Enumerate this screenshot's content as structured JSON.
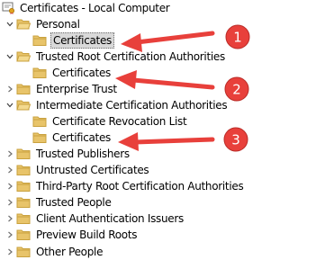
{
  "tree": {
    "root": {
      "label": "Certificates - Local Computer",
      "icon": "certificate-store-icon"
    },
    "items": [
      {
        "label": "Personal",
        "state": "expanded",
        "icon": "folder-open-icon"
      },
      {
        "label": "Certificates",
        "state": "leaf",
        "icon": "folder-icon",
        "selected": true
      },
      {
        "label": "Trusted Root Certification Authorities",
        "state": "expanded",
        "icon": "folder-open-icon"
      },
      {
        "label": "Certificates",
        "state": "leaf",
        "icon": "folder-icon"
      },
      {
        "label": "Enterprise Trust",
        "state": "collapsed",
        "icon": "folder-icon"
      },
      {
        "label": "Intermediate Certification Authorities",
        "state": "expanded",
        "icon": "folder-open-icon"
      },
      {
        "label": "Certificate Revocation List",
        "state": "leaf",
        "icon": "folder-icon"
      },
      {
        "label": "Certificates",
        "state": "leaf",
        "icon": "folder-icon"
      },
      {
        "label": "Trusted Publishers",
        "state": "collapsed",
        "icon": "folder-icon"
      },
      {
        "label": "Untrusted Certificates",
        "state": "collapsed",
        "icon": "folder-icon"
      },
      {
        "label": "Third-Party Root Certification Authorities",
        "state": "collapsed",
        "icon": "folder-icon"
      },
      {
        "label": "Trusted People",
        "state": "collapsed",
        "icon": "folder-icon"
      },
      {
        "label": "Client Authentication Issuers",
        "state": "collapsed",
        "icon": "folder-icon"
      },
      {
        "label": "Preview Build Roots",
        "state": "collapsed",
        "icon": "folder-icon"
      },
      {
        "label": "Other People",
        "state": "collapsed",
        "icon": "folder-icon"
      }
    ]
  },
  "annotations": {
    "color": "#e8403b",
    "badges": [
      {
        "number": "1"
      },
      {
        "number": "2"
      },
      {
        "number": "3"
      }
    ]
  },
  "colors": {
    "folder": "#e8c46a",
    "folder_dark": "#c9a13e",
    "selection": "#d9d9d9"
  }
}
